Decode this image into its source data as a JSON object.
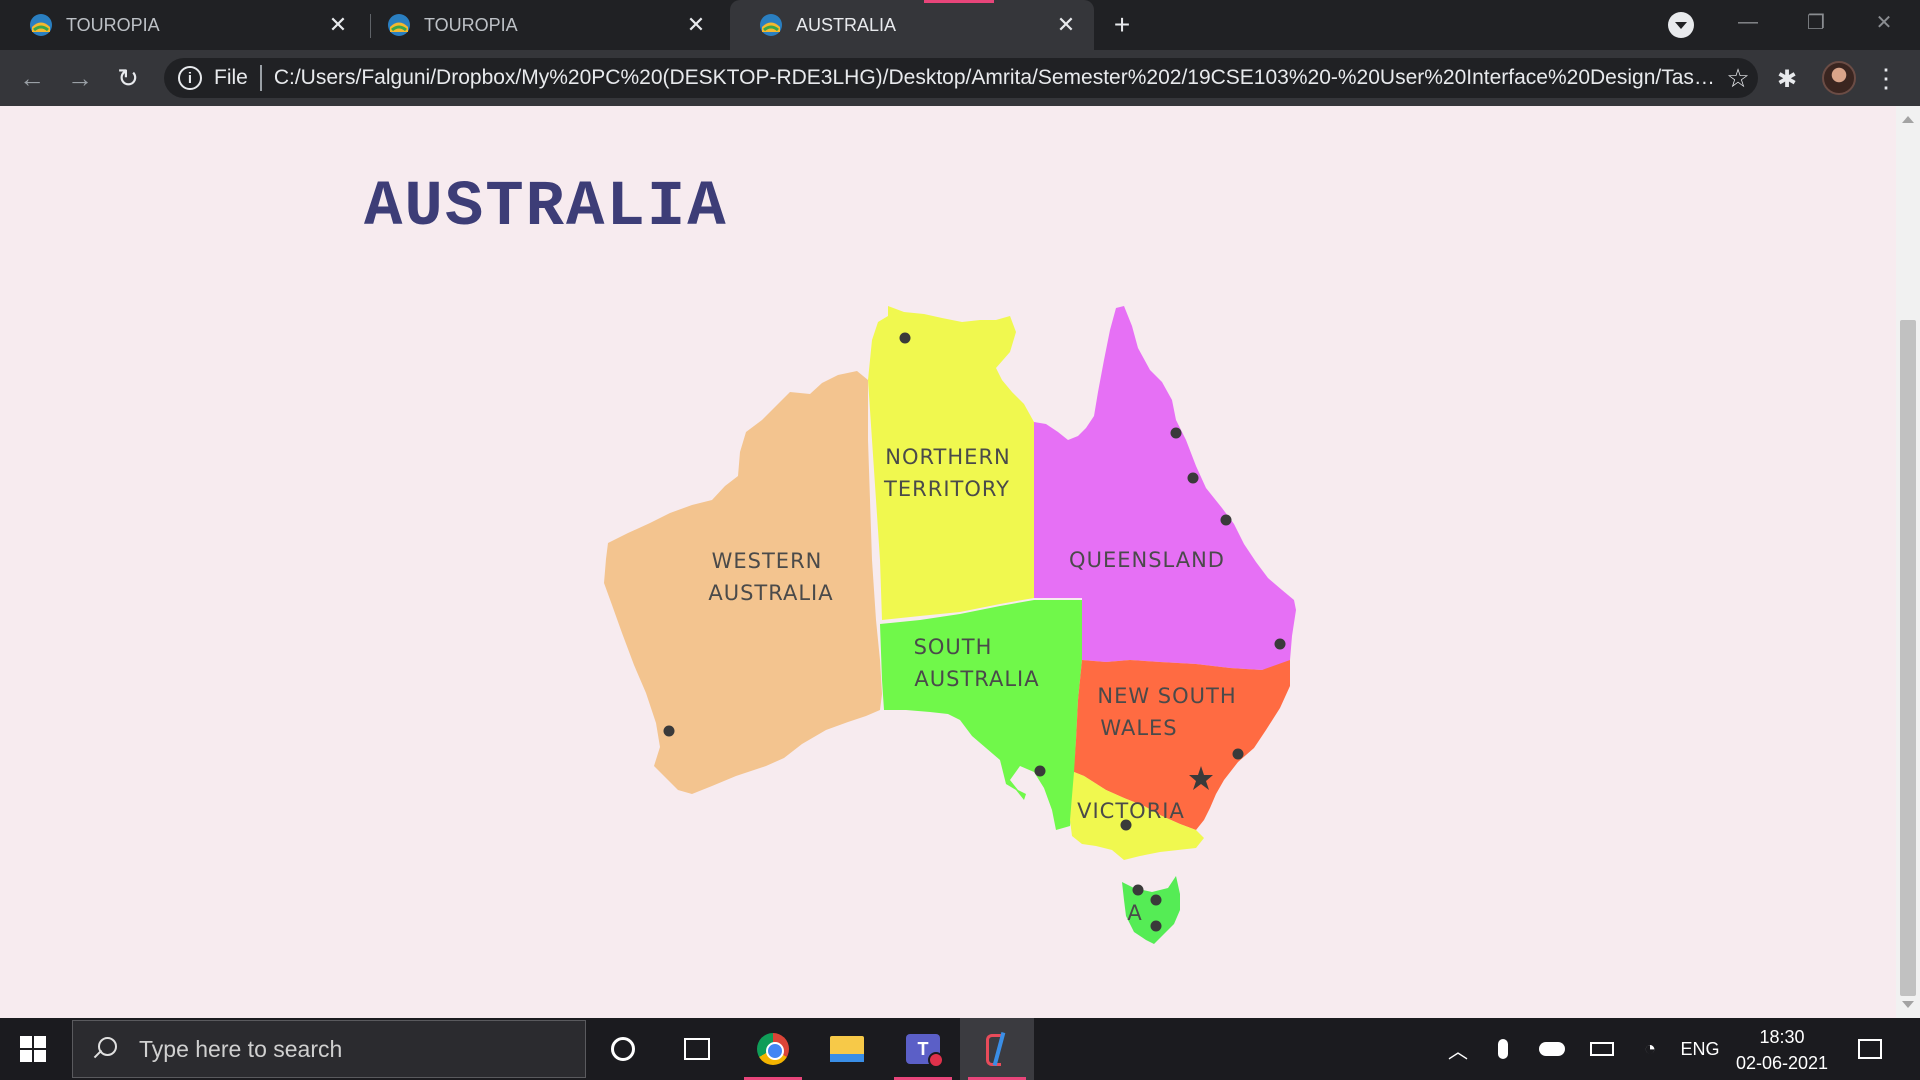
{
  "browser": {
    "tabs": [
      {
        "title": "TOUROPIA",
        "favicon": "globe-favicon-icon",
        "active": false
      },
      {
        "title": "TOUROPIA",
        "favicon": "globe-favicon-icon",
        "active": false
      },
      {
        "title": "AUSTRALIA",
        "favicon": "globe-favicon-icon",
        "active": true
      }
    ],
    "address_bar": {
      "scheme_label": "File",
      "url": "C:/Users/Falguni/Dropbox/My%20PC%20(DESKTOP-RDE3LHG)/Desktop/Amrita/Semester%202/19CSE103%20-%20User%20Interface%20Design/Task%2..."
    }
  },
  "page": {
    "title": "AUSTRALIA",
    "map": {
      "regions": [
        {
          "id": "western-australia",
          "line1": "WESTERN",
          "line2": "AUSTRALIA",
          "color": "#f3c48f"
        },
        {
          "id": "northern-territory",
          "line1": "NORTHERN",
          "line2": "TERRITORY",
          "color": "#f0f84f"
        },
        {
          "id": "queensland",
          "line1": "QUEENSLAND",
          "line2": "",
          "color": "#e670f5"
        },
        {
          "id": "south-australia",
          "line1": "SOUTH",
          "line2": "AUSTRALIA",
          "color": "#70f84a"
        },
        {
          "id": "new-south-wales",
          "line1": "NEW SOUTH",
          "line2": "WALES",
          "color": "#ff6b42"
        },
        {
          "id": "victoria",
          "line1": "VICTORIA",
          "line2": "",
          "color": "#f0f84f"
        },
        {
          "id": "tasmania",
          "line1": "A",
          "line2": "",
          "color": "#55ec55"
        }
      ]
    }
  },
  "taskbar": {
    "search_placeholder": "Type here to search",
    "language": "ENG",
    "time": "18:30",
    "date": "02-06-2021"
  }
}
